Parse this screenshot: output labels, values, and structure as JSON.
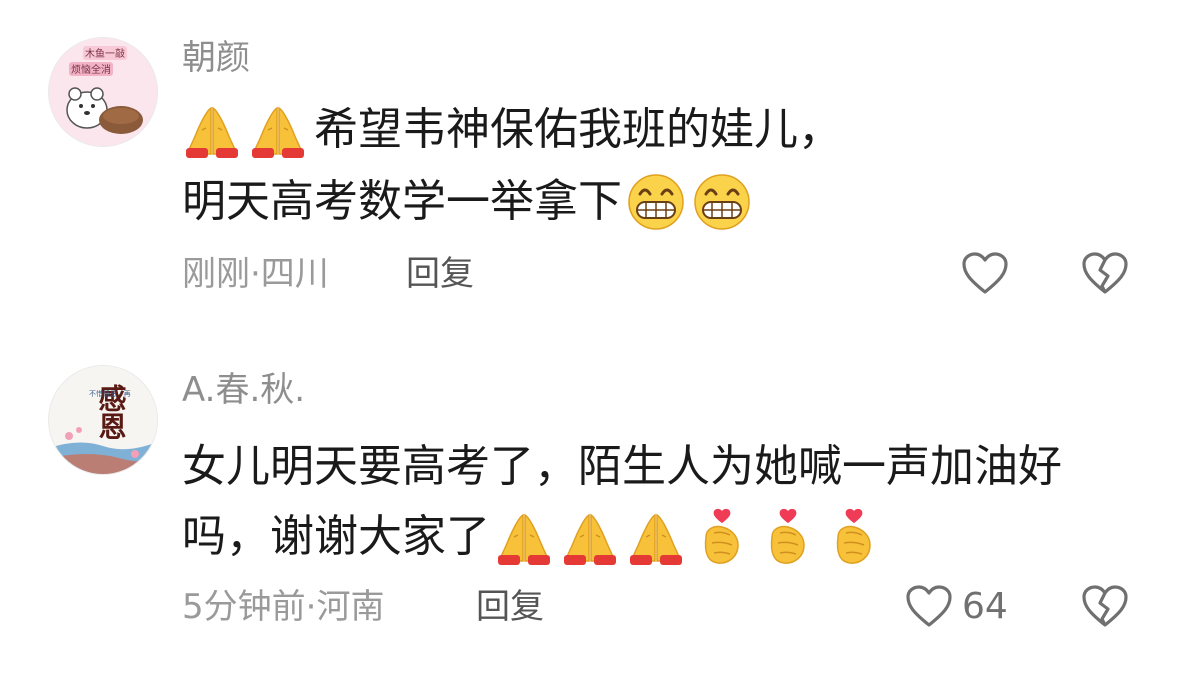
{
  "comments": [
    {
      "avatar": {
        "icon": "bear-sticker-avatar",
        "badge_line1": "木鱼一敲",
        "badge_line2": "烦恼全消"
      },
      "username": "朝颜",
      "text_line1": "希望韦神保佑我班的娃儿，",
      "text_line2": "明天高考数学一举拿下",
      "emoji_line1": [
        "pray-emoji",
        "pray-emoji"
      ],
      "emoji_line2": [
        "grin-emoji",
        "grin-emoji"
      ],
      "meta": "刚刚·四川",
      "reply_label": "回复",
      "like_count": "",
      "icons": {
        "like": "heart-outline-icon",
        "dislike": "broken-heart-icon"
      }
    },
    {
      "avatar": {
        "icon": "calligraphy-avatar",
        "title": "感恩",
        "side_text": "不惜感恩 · 再"
      },
      "username": "A.春.秋.",
      "text_line1": "女儿明天要高考了，陌生人为她喊一声加油好",
      "text_line2": "吗，谢谢大家了",
      "emoji_line2": [
        "pray-emoji",
        "pray-emoji",
        "pray-emoji",
        "finger-heart-emoji",
        "finger-heart-emoji",
        "finger-heart-emoji"
      ],
      "meta": "5分钟前·河南",
      "reply_label": "回复",
      "like_count": "64",
      "icons": {
        "like": "heart-outline-icon",
        "dislike": "broken-heart-icon"
      }
    }
  ],
  "colors": {
    "username": "#8e8e8e",
    "text": "#1a1a1a",
    "meta": "#9a9a9a",
    "reply": "#555555",
    "icon": "#707070"
  }
}
